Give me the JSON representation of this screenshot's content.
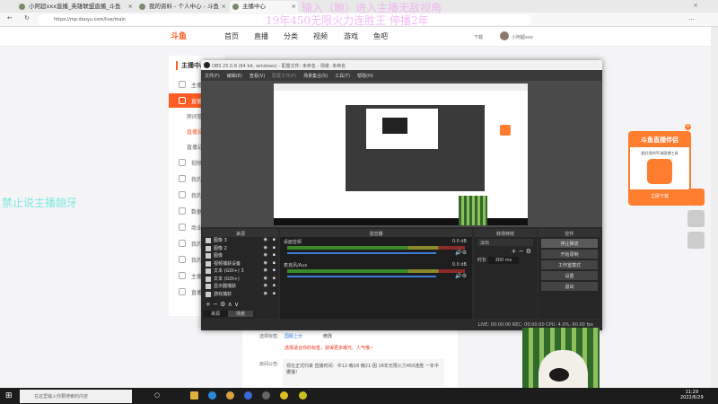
{
  "browser": {
    "tabs": [
      "小阿超xxx直播_英雄联盟直播_斗鱼",
      "我的资料 - 个人中心 - 斗鱼",
      "主播中心"
    ],
    "url": "https://mp.douyu.com/live/main"
  },
  "header": {
    "logo": "斗鱼",
    "nav": [
      "首页",
      "直播",
      "分类",
      "视频",
      "游戏",
      "鱼吧"
    ],
    "download": "下载",
    "user": "小阿超xxx"
  },
  "sidebar": {
    "title": "主播中心",
    "items": [
      "主播",
      "直播",
      "房间管理",
      "直播设置",
      "直播记录",
      "视频",
      "我的",
      "我的",
      "数据",
      "商业",
      "我的",
      "我的",
      "主播",
      "直播"
    ]
  },
  "obs": {
    "title": "OBS 25.0.8 (64 bit, windows) - 配置文件: 未命名 - 场景: 未命名",
    "menu": [
      "文件(F)",
      "编辑(E)",
      "查看(V)",
      "配置文件(P)",
      "场景集合(S)",
      "工具(T)",
      "帮助(H)"
    ],
    "docks": {
      "sources": "来源",
      "mixer": "混音器",
      "transitions": "转场特效",
      "controls": "控件"
    },
    "sources": [
      "图像 3",
      "图像 2",
      "图像",
      "视频捕获设备",
      "文本 (GDI+) 3",
      "文本 (GDI+)",
      "显示器捕获",
      "游戏捕获"
    ],
    "mixer": [
      {
        "name": "桌面音频",
        "db": "0.0 dB"
      },
      {
        "name": "麦克风/Aux",
        "db": "0.0 dB"
      }
    ],
    "transition": {
      "value": "淡出",
      "duration_label": "时长",
      "duration": "300 ms"
    },
    "controls": [
      "停止推流",
      "开始录制",
      "工作室模式",
      "设置",
      "退出"
    ],
    "bottom_tabs": [
      "来源",
      "场景"
    ],
    "status": "LIVE: 00:00:00   REC: 00:00:00   CPU: 4.0%, 60.00 fps"
  },
  "content": {
    "tag_label": "选择标签:",
    "tag": "国服上分",
    "edit": "修改",
    "tag_hint": "选择适合你的标签，获得更多曝光、人气哦~",
    "notice_label": "房间公告:",
    "notice": "现在正式归来 直播时间：中12-晚18 晚21-困 18年无限火力450连胜 一年半腰播！"
  },
  "promo": {
    "title": "斗鱼直播伴侣",
    "subtitle": "超好用的PC端直播工具",
    "button": "立即下载"
  },
  "overlay": {
    "line1": "输入（鲍）进入主播无敌视角",
    "line2": "19年450无限火力连胜王 停播2年",
    "left": "禁止说主播龅牙"
  },
  "taskbar": {
    "search": "在这里输入你要搜索的内容",
    "time": "11:29",
    "date": "2022/6/29"
  },
  "colors": {
    "accent": "#ff5d23",
    "overlay_pink": "#f0b0f0",
    "overlay_cyan": "#7ee8e0"
  }
}
